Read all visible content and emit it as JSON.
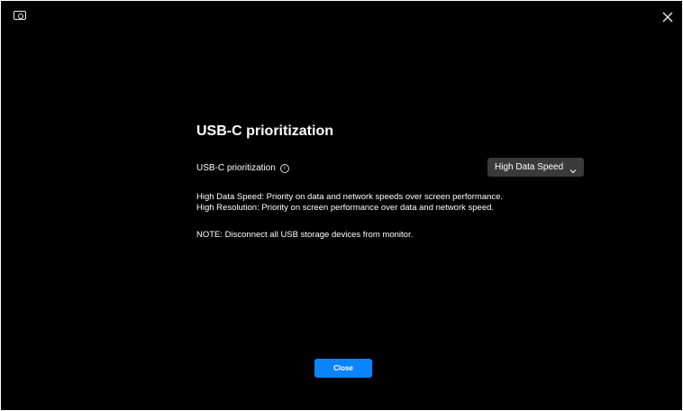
{
  "window": {
    "background_color": "#000000",
    "app_icon": "monitor-icon",
    "close_icon": "close-icon"
  },
  "main": {
    "title": "USB-C prioritization",
    "setting": {
      "label": "USB-C prioritization",
      "info_icon": "info-icon",
      "dropdown": {
        "selected_value": "High Data Speed",
        "chevron_icon": "chevron-down-icon",
        "background_color": "#3a3a3a"
      }
    },
    "descriptions": [
      "High Data Speed: Priority on data and network speeds over screen performance.",
      "High Resolution:  Priority on screen performance over data and network speed."
    ],
    "note": "NOTE: Disconnect all USB storage devices from monitor."
  },
  "footer": {
    "close_button_label": "Close",
    "accent_color": "#0a84ff"
  }
}
